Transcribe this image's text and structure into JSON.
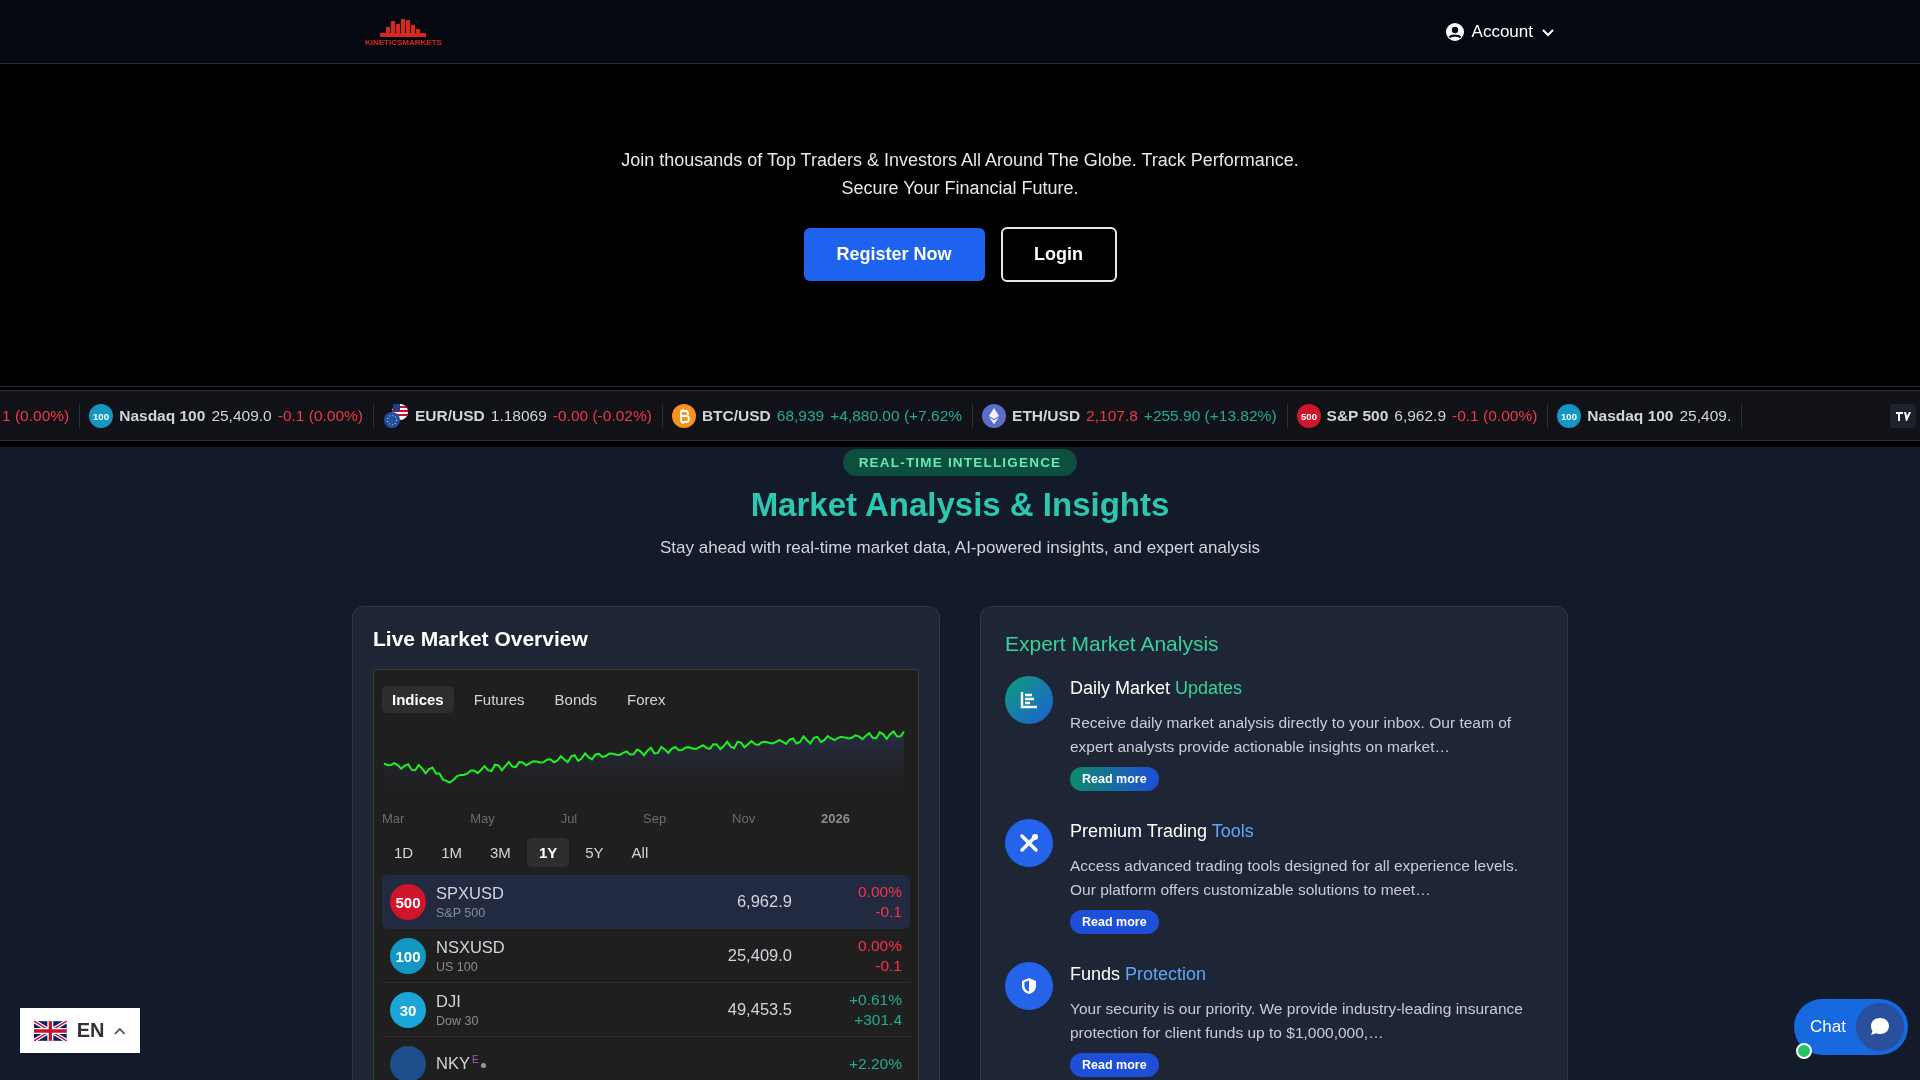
{
  "header": {
    "logo_text": "KINETICSMARKETS",
    "account_label": "Account"
  },
  "hero": {
    "tagline_lines": [
      "Join thousands of Top Traders & Investors All Around The Globe. Track Performance.",
      "Secure Your Financial Future."
    ],
    "buttons": [
      {
        "label": "Register Now",
        "kind": "primary"
      },
      {
        "label": "Login",
        "kind": "outline"
      }
    ]
  },
  "ticker": {
    "items": [
      {
        "kind": "partial",
        "change": "1 (0.00%)",
        "negative": true
      },
      {
        "kind": "index",
        "badge": "100",
        "color": "#1597c4",
        "name": "Nasdaq 100",
        "price": "25,409.0",
        "price_up": false,
        "price_down": false,
        "change": "-0.1 (0.00%)",
        "negative": true
      },
      {
        "kind": "forex",
        "name": "EUR/USD",
        "price": "1.18069",
        "price_up": false,
        "price_down": false,
        "change": "-0.00 (-0.02%)",
        "negative": true
      },
      {
        "kind": "bitcoin",
        "name": "BTC/USD",
        "price": "68,939",
        "price_up": true,
        "price_down": false,
        "change": "+4,880.00 (+7.62%",
        "negative": false
      },
      {
        "kind": "ether",
        "name": "ETH/USD",
        "price": "2,107.8",
        "price_up": false,
        "price_down": true,
        "change": "+255.90 (+13.82%)",
        "negative": false
      },
      {
        "kind": "index",
        "badge": "500",
        "color": "#d0152b",
        "name": "S&P 500",
        "price": "6,962.9",
        "price_up": false,
        "price_down": false,
        "change": "-0.1 (0.00%)",
        "negative": true
      },
      {
        "kind": "index",
        "badge": "100",
        "color": "#1597c4",
        "name": "Nasdaq 100",
        "price": "25,409.",
        "price_up": false,
        "price_down": false
      }
    ]
  },
  "intro": {
    "badge": "REAL-TIME INTELLIGENCE",
    "title": "Market Analysis & Insights",
    "subtitle": "Stay ahead with real-time market data, AI-powered insights, and expert analysis"
  },
  "market": {
    "title": "Live Market Overview",
    "tabs": [
      {
        "label": "Indices",
        "selected": true
      },
      {
        "label": "Futures",
        "selected": false
      },
      {
        "label": "Bonds",
        "selected": false
      },
      {
        "label": "Forex",
        "selected": false
      }
    ],
    "x_labels": [
      {
        "label": "Mar",
        "kind": "month"
      },
      {
        "label": "May",
        "kind": "month"
      },
      {
        "label": "Jul",
        "kind": "month"
      },
      {
        "label": "Sep",
        "kind": "month"
      },
      {
        "label": "Nov",
        "kind": "month"
      },
      {
        "label": "2026",
        "kind": "year"
      }
    ],
    "ranges": [
      {
        "label": "1D",
        "selected": false
      },
      {
        "label": "1M",
        "selected": false
      },
      {
        "label": "3M",
        "selected": false
      },
      {
        "label": "1Y",
        "selected": true
      },
      {
        "label": "5Y",
        "selected": false
      },
      {
        "label": "All",
        "selected": false
      }
    ],
    "rows": [
      {
        "badge": "500",
        "color": "#d0152b",
        "symbol": "SPXUSD",
        "name": "S&P 500",
        "price": "6,962.9",
        "change_pct": "0.00%",
        "change_abs": "-0.1",
        "negative": true,
        "selected": true
      },
      {
        "badge": "100",
        "color": "#1597c4",
        "symbol": "NSXUSD",
        "name": "US 100",
        "price": "25,409.0",
        "change_pct": "0.00%",
        "change_abs": "-0.1",
        "negative": true,
        "selected": false
      },
      {
        "badge": "30",
        "color": "#1ba6d9",
        "symbol": "DJI",
        "name": "Dow 30",
        "price": "49,453.5",
        "change_pct": "+0.61%",
        "change_abs": "+301.4",
        "negative": false,
        "selected": false
      },
      {
        "color": "#1d4f8a",
        "symbol": "NKY",
        "flag": "E",
        "change_pct": "+2.20%",
        "negative": false,
        "selected": false
      }
    ]
  },
  "expert": {
    "title": "Expert Market Analysis",
    "items": [
      {
        "kind": "chart",
        "title": "Daily Market",
        "highlight": "Updates",
        "color": "#34d399",
        "text": "Receive daily market analysis directly to your inbox. Our team of expert analysts provide actionable insights on market…",
        "button": "Read more"
      },
      {
        "kind": "tools",
        "title": "Premium Trading",
        "highlight": "Tools",
        "color": "#60a5fa",
        "text": "Access advanced trading tools designed for all experience levels. Our platform offers customizable solutions to meet…",
        "button": "Read more"
      },
      {
        "kind": "shield",
        "title": "Funds",
        "highlight": "Protection",
        "color": "#60a5fa",
        "text": "Your security is our priority. We provide industry-leading insurance protection for client funds up to $1,000,000,…",
        "button": "Read more"
      }
    ]
  },
  "language": {
    "code": "EN"
  },
  "chat": {
    "label": "Chat",
    "online": true
  }
}
